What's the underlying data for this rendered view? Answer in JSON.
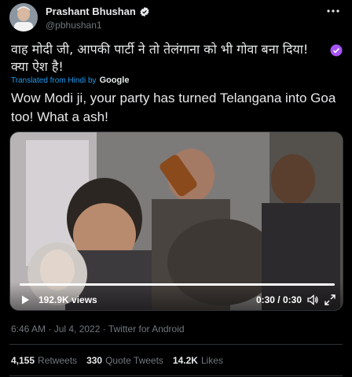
{
  "author": {
    "name": "Prashant Bhushan",
    "handle": "@pbhushan1",
    "avatar": "avatar"
  },
  "tweet": {
    "original_text": "वाह मोदी जी, आपकी पार्टी ने तो तेलंगाना को भी गोवा बना दिया! क्या ऐश है!",
    "translated_from": "Translated from Hindi by",
    "translator": "Google",
    "translation": "Wow Modi ji, your party has turned Telangana into Goa too! What a ash!"
  },
  "video": {
    "views": "192.9K views",
    "time": "0:30 / 0:30",
    "progress": 1.0
  },
  "meta": {
    "timestamp": "6:46 AM · Jul 4, 2022 · Twitter for Android"
  },
  "stats": [
    {
      "count": "4,155",
      "label": "Retweets"
    },
    {
      "count": "330",
      "label": "Quote Tweets"
    },
    {
      "count": "14.2K",
      "label": "Likes"
    }
  ],
  "colors": {
    "background": "#000000",
    "link": "#1d9bf0",
    "secondary": "#71767b",
    "purple": "#a855f7"
  },
  "icons": {
    "verified": "verified-badge-icon",
    "more": "more-icon",
    "translate": "translate-icon",
    "play": "play-icon",
    "volume": "volume-icon",
    "fullscreen": "fullscreen-icon"
  }
}
